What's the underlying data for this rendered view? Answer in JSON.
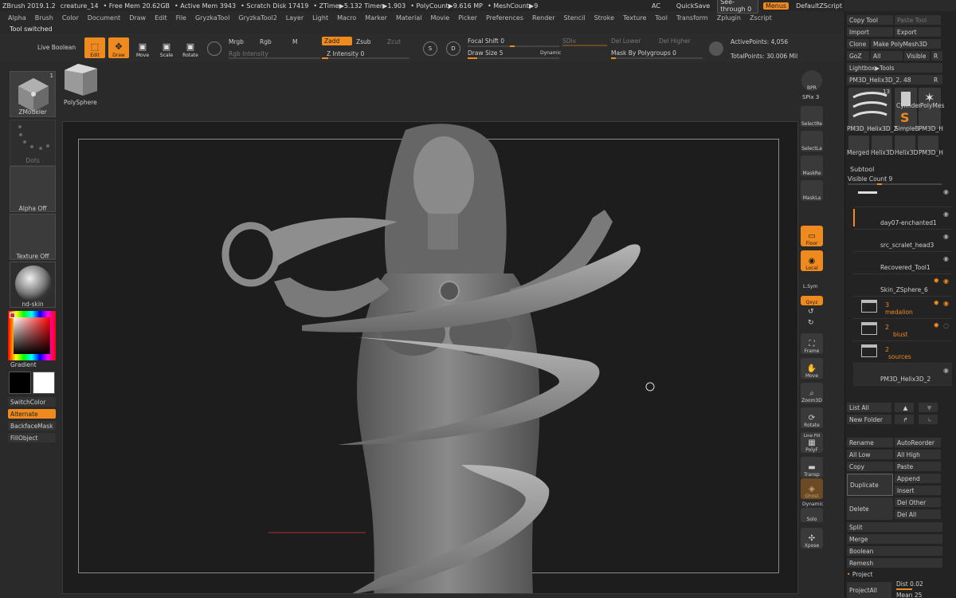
{
  "titlebar": {
    "app": "ZBrush 2019.1.2",
    "document": "creature_14",
    "free_mem": "• Free Mem 20.62GB",
    "active_mem": "• Active Mem 3943",
    "scratch": "• Scratch Disk 17419",
    "ztime": "• ZTime▶5.132 Timer▶1.903",
    "polycount": "• PolyCount▶9.616 MP",
    "meshcount": "• MeshCount▶9",
    "ac": "AC",
    "quicksave": "QuickSave",
    "see_through": "See-through  0",
    "menus": "Menus",
    "default_zscript": "DefaultZScript"
  },
  "menubar": [
    "Alpha",
    "Brush",
    "Color",
    "Document",
    "Draw",
    "Edit",
    "File",
    "GryzkaTool",
    "GryzkaTool2",
    "Layer",
    "Light",
    "Macro",
    "Marker",
    "Material",
    "Movie",
    "Picker",
    "Preferences",
    "Render",
    "Stencil",
    "Stroke",
    "Texture",
    "Tool",
    "Transform",
    "Zplugin",
    "Zscript"
  ],
  "status": "Tool switched",
  "shelf": {
    "live_boolean": "Live Boolean",
    "edit": "Edit",
    "draw": "Draw",
    "move": "Move",
    "scale": "Scale",
    "rotate": "Rotate",
    "mrgb": "Mrgb",
    "rgb": "Rgb",
    "m": "M",
    "zadd": "Zadd",
    "zsub": "Zsub",
    "zcut": "Zcut",
    "rgb_intensity": "Rgb Intensity",
    "z_intensity": "Z Intensity 0",
    "focal_shift": "Focal Shift 0",
    "draw_size": "Draw Size 5",
    "dynamic": "Dynamic",
    "sdiv": "SDiv",
    "del_lower": "Del Lower",
    "del_higher": "Del Higher",
    "mask_by_polygroups": "Mask By Polygroups 0",
    "active_points": "ActivePoints: 4,056",
    "total_points": "TotalPoints: 30.006 Mil",
    "s_label": "S",
    "d_label": "D"
  },
  "leftpanel": {
    "zmodeler": "ZModeler",
    "zmodeler_count": "1",
    "polysphere": "PolySphere",
    "dots": "Dots",
    "alpha_off": "Alpha Off",
    "texture_off": "Texture Off",
    "material": "nd-skin",
    "gradient": "Gradient",
    "switchcolor": "SwitchColor",
    "alternate": "Alternate",
    "backfacemask": "BackfaceMask",
    "fillobject": "FillObject"
  },
  "righttoolbar": {
    "bpr": "BPR",
    "spix": "SPix 3",
    "selectrect": "SelectRe",
    "selectlasso": "SelectLa",
    "maskrect": "MaskRe",
    "masklasso": "MaskLa",
    "floor": "Floor",
    "local": "Local",
    "lsym": "L.Sym",
    "xyz": "Qxyz",
    "frame": "Frame",
    "move": "Move",
    "zoom3d": "Zoom3D",
    "rotate": "Rotate",
    "linefill": "Line Fill",
    "polyf": "PolyF",
    "transp": "Transp",
    "ghost": "Ghost",
    "dynamic": "Dynamic",
    "solo": "Solo",
    "xpose": "Xpose"
  },
  "rightpanel": {
    "copy_tool": "Copy Tool",
    "paste_tool": "Paste Tool",
    "import": "Import",
    "export": "Export",
    "clone": "Clone",
    "make_polymesh": "Make PolyMesh3D",
    "goz": "GoZ",
    "all": "All",
    "visible": "Visible",
    "r": "R",
    "lightbox_tools": "Lightbox▶Tools",
    "current_tool": "PM3D_Helix3D_2. 48",
    "tool_thumbs": [
      "PM3D_Helix3D_2",
      "SimpleB",
      "PM3D_H",
      "Merged",
      "Helix3D",
      "Helix3D",
      "PM3D_H"
    ],
    "cylinder": "Cylinder",
    "polymesh": "PolyMes",
    "thumb_count": "13",
    "subtool_title": "Subtool",
    "visible_count": "Visible Count 9",
    "subtools": [
      {
        "name": "day07-enchanted1",
        "folder": false
      },
      {
        "name": "src_scralet_head3",
        "folder": false
      },
      {
        "name": "Recovered_Tool1",
        "folder": false
      },
      {
        "name": "Skin_ZSphere_6",
        "folder": false
      },
      {
        "name": "medalion",
        "folder": true,
        "count": "3"
      },
      {
        "name": "biust",
        "folder": true,
        "count": "2"
      },
      {
        "name": "sources",
        "folder": true,
        "count": "2"
      },
      {
        "name": "PM3D_Helix3D_2",
        "folder": false
      }
    ],
    "list_all": "List All",
    "new_folder": "New Folder",
    "rename": "Rename",
    "autoreorder": "AutoReorder",
    "all_low": "All Low",
    "all_high": "All High",
    "copy": "Copy",
    "paste": "Paste",
    "duplicate": "Duplicate",
    "append": "Append",
    "insert": "Insert",
    "delete": "Delete",
    "del_other": "Del Other",
    "del_all": "Del All",
    "split": "Split",
    "merge": "Merge",
    "boolean": "Boolean",
    "remesh": "Remesh",
    "project": "Project",
    "dist": "Dist 0.02",
    "mean": "Mean 25",
    "project_all": "ProjectAll"
  },
  "colors": {
    "accent": "#ef8a1e",
    "bg": "#2a2a2a",
    "canvas": "#1d1d1d"
  }
}
